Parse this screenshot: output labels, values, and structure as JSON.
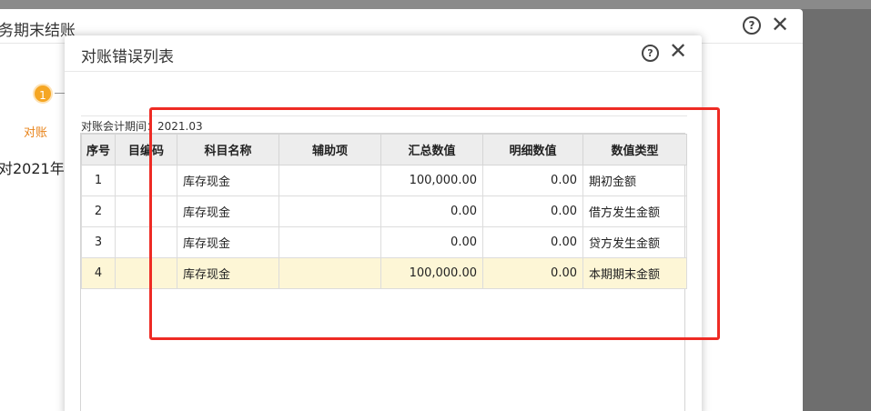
{
  "background_dialog": {
    "title": "务期末结账",
    "step_number": "1",
    "step_label": "对账",
    "description": "对2021年"
  },
  "dialog": {
    "title": "对账错误列表",
    "help_symbol": "?",
    "close_symbol": "✕",
    "period_label": "对账会计期间：2021.03"
  },
  "table": {
    "headers": [
      "序号",
      "目编码",
      "科目名称",
      "辅助项",
      "汇总数值",
      "明细数值",
      "数值类型"
    ],
    "rows": [
      {
        "no": "1",
        "code": "",
        "name": "库存现金",
        "aux": "",
        "total": "100,000.00",
        "detail": "0.00",
        "type": "期初金额"
      },
      {
        "no": "2",
        "code": "",
        "name": "库存现金",
        "aux": "",
        "total": "0.00",
        "detail": "0.00",
        "type": "借方发生金额"
      },
      {
        "no": "3",
        "code": "",
        "name": "库存现金",
        "aux": "",
        "total": "0.00",
        "detail": "0.00",
        "type": "贷方发生金额"
      },
      {
        "no": "4",
        "code": "",
        "name": "库存现金",
        "aux": "",
        "total": "100,000.00",
        "detail": "0.00",
        "type": "本期期末金额"
      }
    ],
    "highlighted_row": 4
  },
  "colors": {
    "annotation_box": "#ee2b24",
    "highlight_row": "#fdf6d6",
    "step_accent": "#f5a623"
  }
}
